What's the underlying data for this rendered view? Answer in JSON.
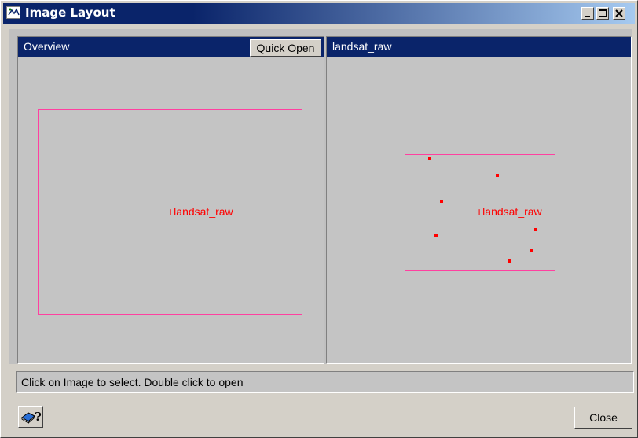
{
  "window": {
    "title": "Image Layout",
    "icon": "app-layout-icon",
    "controls": {
      "minimize": "_",
      "maximize": "□",
      "close": "x"
    }
  },
  "overview": {
    "title": "Overview",
    "quick_open_label": "Quick Open",
    "image_label": "+landsat_raw"
  },
  "detail": {
    "title": "landsat_raw",
    "image_label": "+landsat_raw",
    "point_color": "#ff0000"
  },
  "status": {
    "text": "Click on Image to select. Double click to open"
  },
  "footer": {
    "help_icon": "help-book-icon",
    "close_label": "Close"
  },
  "colors": {
    "title_bar": "#0a246a",
    "panel_header": "#0a246a",
    "footprint_outline": "#ff40a0",
    "label_red": "#ff0000"
  }
}
